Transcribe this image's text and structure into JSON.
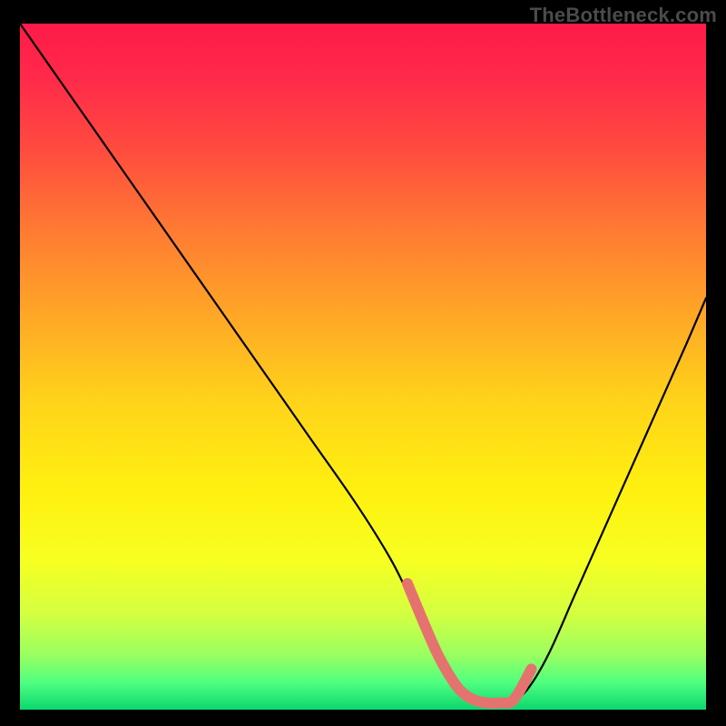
{
  "watermark": "TheBottleneck.com",
  "chart_data": {
    "type": "line",
    "title": "",
    "xlabel": "",
    "ylabel": "",
    "xlim": [
      0,
      100
    ],
    "ylim": [
      0,
      100
    ],
    "grid": false,
    "legend": false,
    "series": [
      {
        "name": "bottleneck-curve",
        "x": [
          0,
          7,
          14,
          21,
          28,
          35,
          42,
          49,
          54,
          57,
          60,
          62,
          64,
          66,
          68,
          70,
          72,
          74,
          77,
          81,
          85,
          89,
          93,
          97,
          100
        ],
        "y": [
          100,
          90,
          80,
          70,
          60,
          50,
          40,
          30,
          22,
          16,
          10,
          6,
          3,
          1.5,
          1,
          1,
          1.5,
          3,
          8,
          17,
          26,
          35,
          44,
          53,
          60
        ]
      }
    ],
    "highlight_region": {
      "name": "optimal-range",
      "x": [
        57.5,
        75.5
      ],
      "y": [
        1,
        1
      ]
    },
    "background_gradient": {
      "stops": [
        {
          "offset": 0.0,
          "color": "#ff1a4a"
        },
        {
          "offset": 0.08,
          "color": "#ff2a4a"
        },
        {
          "offset": 0.18,
          "color": "#ff4a3f"
        },
        {
          "offset": 0.3,
          "color": "#ff7a33"
        },
        {
          "offset": 0.42,
          "color": "#ffa527"
        },
        {
          "offset": 0.55,
          "color": "#ffd31a"
        },
        {
          "offset": 0.68,
          "color": "#fff010"
        },
        {
          "offset": 0.78,
          "color": "#f7ff20"
        },
        {
          "offset": 0.86,
          "color": "#d4ff40"
        },
        {
          "offset": 0.92,
          "color": "#9aff60"
        },
        {
          "offset": 0.96,
          "color": "#50ff80"
        },
        {
          "offset": 1.0,
          "color": "#0bd86e"
        }
      ]
    }
  }
}
